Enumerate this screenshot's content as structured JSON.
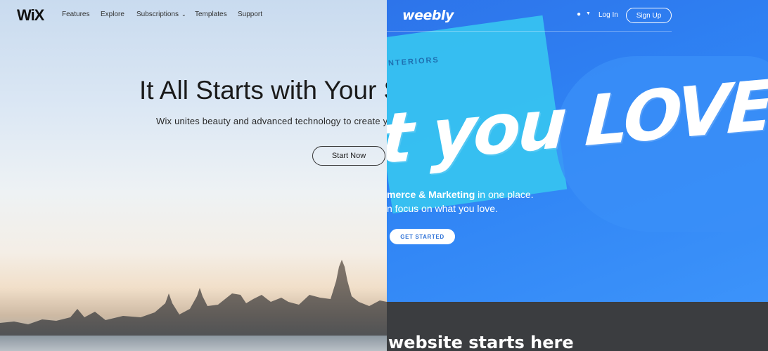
{
  "wix": {
    "logo": "WiX",
    "nav": [
      {
        "label": "Features"
      },
      {
        "label": "Explore"
      },
      {
        "label": "Subscriptions"
      },
      {
        "label": "Templates"
      },
      {
        "label": "Support"
      }
    ],
    "title": "It All Starts with Your St",
    "subtitle": "Wix unites beauty and advanced technology to create you",
    "cta": "Start Now"
  },
  "weebly": {
    "logo": "weebly",
    "login": "Log In",
    "signup": "Sign Up",
    "card_label": "NTERIORS",
    "brush_text": "t you LOVE",
    "line1_bold": "merce & Marketing",
    "line1_rest": " in one place.",
    "line2": "n focus on what you love.",
    "cta": "GET STARTED",
    "bottom_heading": "website starts here"
  },
  "colors": {
    "weebly_blue": "#2f7ff0",
    "weebly_dark": "#3b3d40",
    "wix_text": "#1a1a1a"
  },
  "icons": [
    "globe-icon",
    "chevron-down-icon"
  ]
}
